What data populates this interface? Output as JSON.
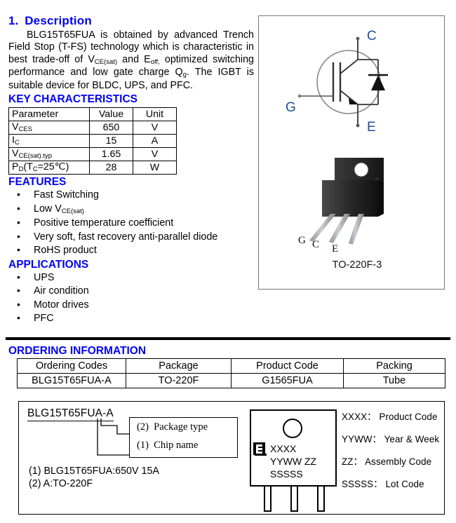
{
  "document": {
    "section_number": "1.",
    "section_title": "Description",
    "description_parts": {
      "lead": "BLG15T65FUA is obtained by advanced Trench Field Stop (T-FS) technology which is characteristic in best trade-off of ",
      "v1_base": "V",
      "v1_sub": "CE(sat)",
      "mid1": " and ",
      "e1_base": "E",
      "e1_sub": "off,",
      "mid2": " optimized switching performance and low gate charge ",
      "q_base": "Q",
      "q_sub": "g",
      "tail": ". The IGBT is suitable device for BLDC, UPS, and PFC."
    }
  },
  "key_characteristics": {
    "heading": "KEY CHARACTERISTICS",
    "headers": [
      "Parameter",
      "Value",
      "Unit"
    ],
    "rows": [
      {
        "param_base": "V",
        "param_sub": "CES",
        "param_sub2": "",
        "value": "650",
        "unit": "V"
      },
      {
        "param_base": "I",
        "param_sub": "C",
        "param_sub2": "",
        "value": "15",
        "unit": "A"
      },
      {
        "param_base": "V",
        "param_sub": "CE(sat).typ",
        "param_sub2": "",
        "value": "1.65",
        "unit": "V"
      },
      {
        "param_base": "P",
        "param_sub": "D",
        "param_sub2": "(T",
        "param_sub3": "C",
        "param_sub4": "=25℃)",
        "value": "28",
        "unit": "W"
      }
    ]
  },
  "features": {
    "heading": "FEATURES",
    "items": [
      {
        "text": "Fast Switching",
        "sub_base": "",
        "sub": ""
      },
      {
        "text": "Low V",
        "sub_base": "V",
        "sub": "CE(sat)"
      },
      {
        "text": "Positive temperature coefficient",
        "sub_base": "",
        "sub": ""
      },
      {
        "text": "Very soft, fast recovery anti-parallel diode",
        "sub_base": "",
        "sub": ""
      },
      {
        "text": "RoHS product",
        "sub_base": "",
        "sub": ""
      }
    ]
  },
  "applications": {
    "heading": "APPLICATIONS",
    "items": [
      "UPS",
      "Air condition",
      "Motor drives",
      "PFC"
    ]
  },
  "symbol_diagram": {
    "collector_label": "C",
    "gate_label": "G",
    "emitter_label": "E",
    "label_color": "#1f4e9c"
  },
  "package_photo": {
    "caption": "TO-220F-3",
    "pin_labels": [
      "G",
      "C",
      "E"
    ]
  },
  "ordering_information": {
    "heading": "ORDERING INFORMATION",
    "headers": [
      "Ordering Codes",
      "Package",
      "Product Code",
      "Packing"
    ],
    "rows": [
      [
        "BLG15T65FUA-A",
        "TO-220F",
        "G1565FUA",
        "Tube"
      ]
    ]
  },
  "part_number_breakdown": {
    "part_number": "BLG15T65FUA-A",
    "legend": [
      {
        "index": "(2)",
        "label": "Package type"
      },
      {
        "index": "(1)",
        "label": "Chip name"
      }
    ],
    "notes": [
      "(1) BLG15T65FUA:650V 15A",
      "(2) A:TO-220F"
    ]
  },
  "marking_diagram": {
    "logo_name": "brand-logo",
    "lines": [
      "XXXX",
      "YYWW  ZZ",
      "SSSSS"
    ],
    "legend": [
      "XXXX： Product Code",
      "YYWW： Year & Week",
      "ZZ： Assembly Code",
      "SSSSS： Lot Code"
    ]
  },
  "colors": {
    "heading_blue": "#0000ff",
    "symbol_label": "#1f4e9c",
    "frame_gray": "#777777"
  }
}
